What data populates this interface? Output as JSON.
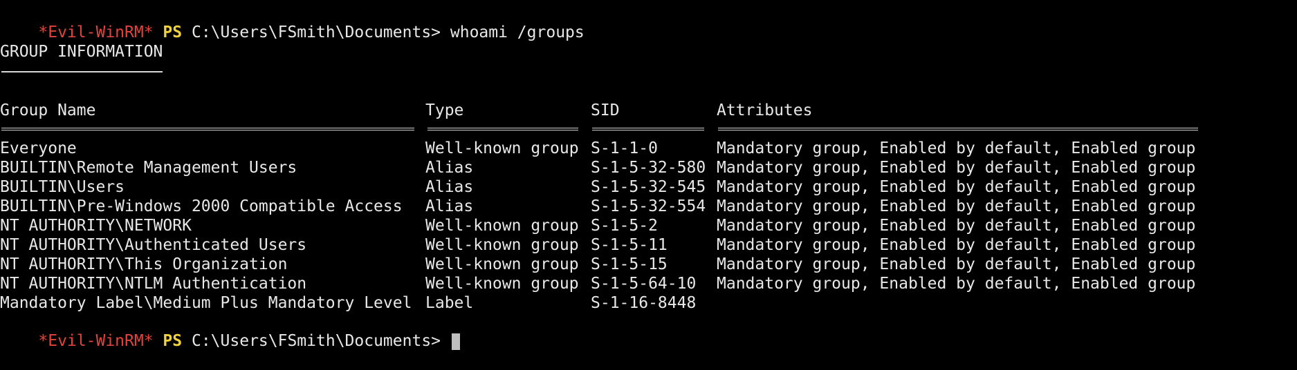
{
  "colors": {
    "background": "#000000",
    "text": "#e8e8e8",
    "prompt_tag": "#e0443c",
    "prompt_ps": "#f0d23a"
  },
  "prompt": {
    "tag": "*Evil-WinRM*",
    "ps": "PS",
    "path": "C:\\Users\\FSmith\\Documents>"
  },
  "command": "whoami /groups",
  "section_title": "GROUP INFORMATION",
  "table": {
    "headers": {
      "name": "Group Name",
      "type": "Type",
      "sid": "SID",
      "attributes": "Attributes"
    },
    "rows": [
      {
        "name": "Everyone",
        "type": "Well-known group",
        "sid": "S-1-1-0",
        "attributes": "Mandatory group, Enabled by default, Enabled group"
      },
      {
        "name": "BUILTIN\\Remote Management Users",
        "type": "Alias",
        "sid": "S-1-5-32-580",
        "attributes": "Mandatory group, Enabled by default, Enabled group"
      },
      {
        "name": "BUILTIN\\Users",
        "type": "Alias",
        "sid": "S-1-5-32-545",
        "attributes": "Mandatory group, Enabled by default, Enabled group"
      },
      {
        "name": "BUILTIN\\Pre-Windows 2000 Compatible Access",
        "type": "Alias",
        "sid": "S-1-5-32-554",
        "attributes": "Mandatory group, Enabled by default, Enabled group"
      },
      {
        "name": "NT AUTHORITY\\NETWORK",
        "type": "Well-known group",
        "sid": "S-1-5-2",
        "attributes": "Mandatory group, Enabled by default, Enabled group"
      },
      {
        "name": "NT AUTHORITY\\Authenticated Users",
        "type": "Well-known group",
        "sid": "S-1-5-11",
        "attributes": "Mandatory group, Enabled by default, Enabled group"
      },
      {
        "name": "NT AUTHORITY\\This Organization",
        "type": "Well-known group",
        "sid": "S-1-5-15",
        "attributes": "Mandatory group, Enabled by default, Enabled group"
      },
      {
        "name": "NT AUTHORITY\\NTLM Authentication",
        "type": "Well-known group",
        "sid": "S-1-5-64-10",
        "attributes": "Mandatory group, Enabled by default, Enabled group"
      },
      {
        "name": "Mandatory Label\\Medium Plus Mandatory Level",
        "type": "Label",
        "sid": "S-1-16-8448",
        "attributes": ""
      }
    ]
  }
}
